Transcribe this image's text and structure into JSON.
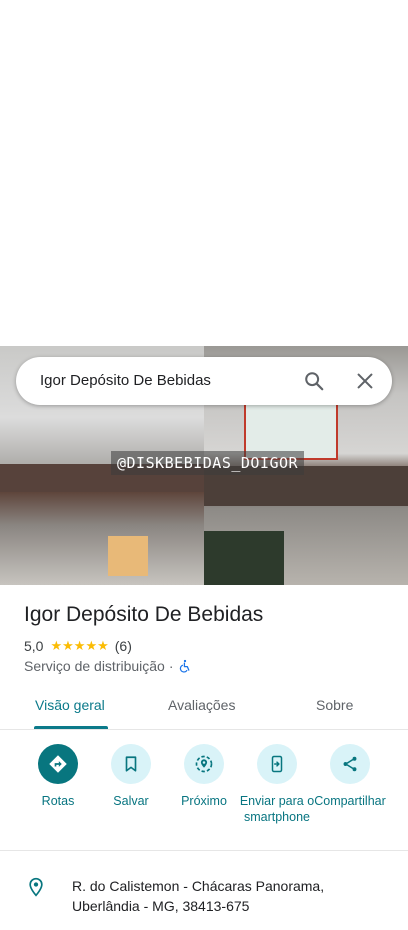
{
  "search": {
    "query": "Igor Depósito De Bebidas"
  },
  "photo": {
    "overlay_text": "@DISKBEBIDAS_DOIGOR"
  },
  "place": {
    "title": "Igor Depósito De Bebidas",
    "rating": "5,0",
    "stars": [
      "★",
      "★",
      "★",
      "★",
      "★"
    ],
    "review_count": "(6)",
    "category": "Serviço de distribuição",
    "separator": "·"
  },
  "tabs": [
    {
      "label": "Visão geral",
      "active": true
    },
    {
      "label": "Avaliações",
      "active": false
    },
    {
      "label": "Sobre",
      "active": false
    }
  ],
  "actions": [
    {
      "label": "Rotas",
      "icon": "directions-icon"
    },
    {
      "label": "Salvar",
      "icon": "bookmark-icon"
    },
    {
      "label": "Próximo",
      "icon": "nearby-icon"
    },
    {
      "label": "Enviar para o smartphone",
      "icon": "send-to-phone-icon"
    },
    {
      "label": "Compartilhar",
      "icon": "share-icon"
    }
  ],
  "address": {
    "text": "R. do Calistemon - Chácaras Panorama, Uberlândia - MG, 38413-675"
  },
  "colors": {
    "accent": "#0b7a8a",
    "star": "#fbbc04",
    "action_bg": "#d9f3f8"
  }
}
